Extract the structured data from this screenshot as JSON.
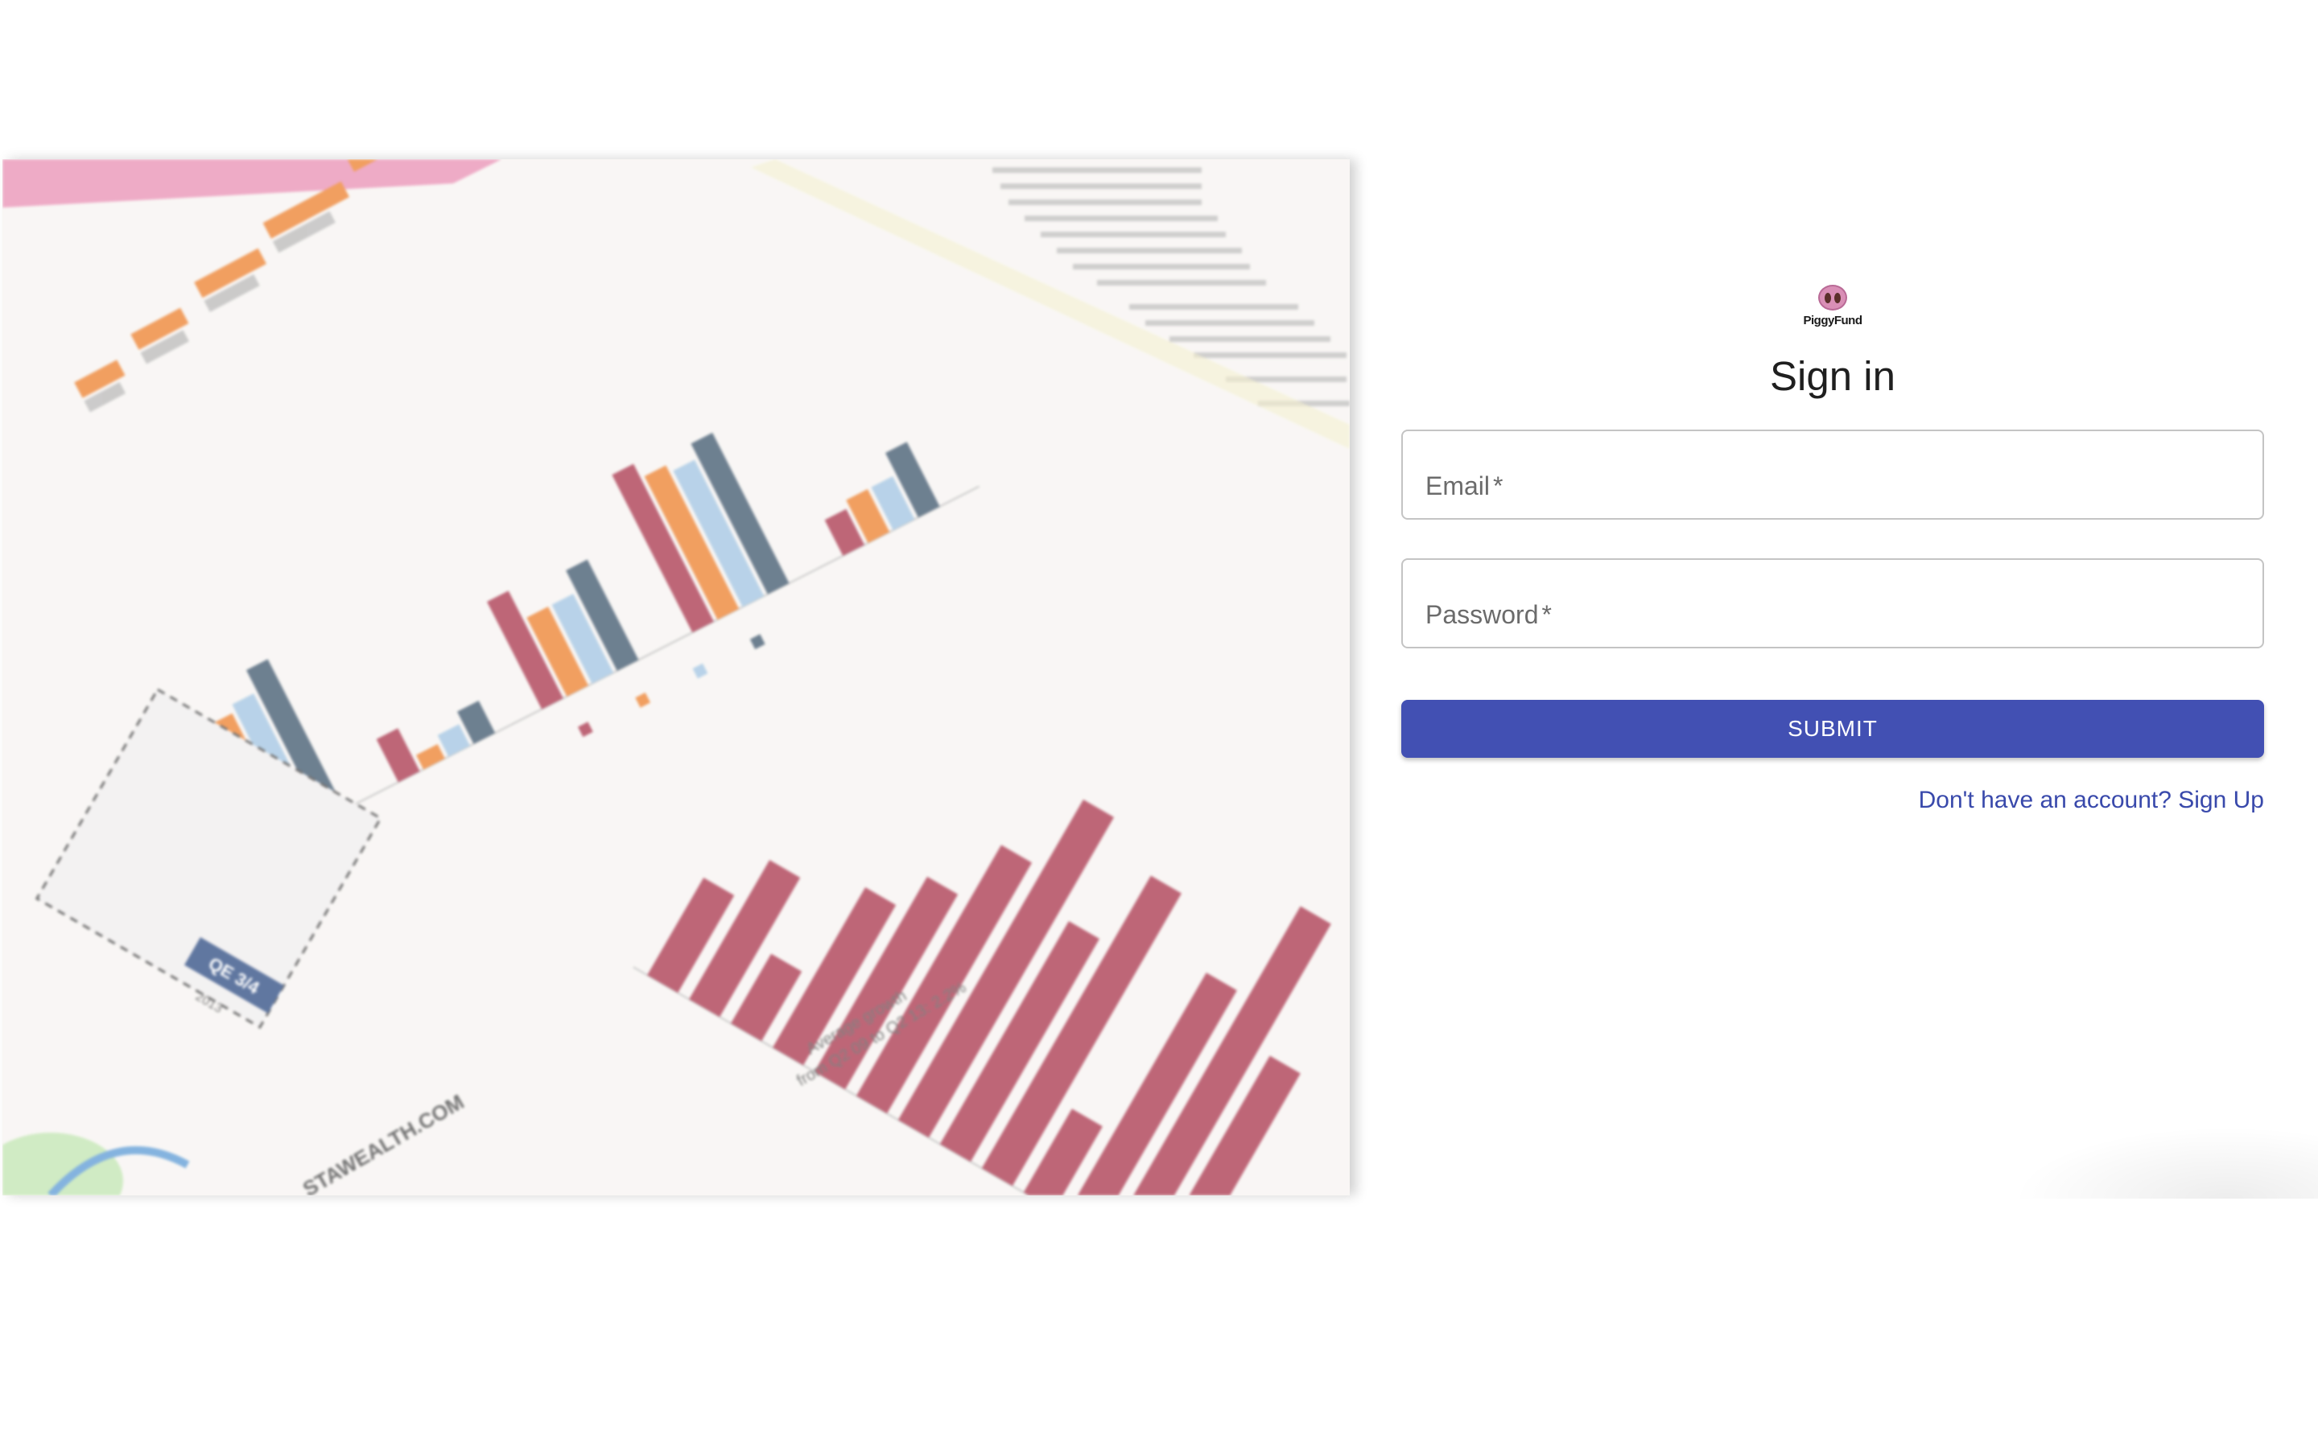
{
  "hero": {
    "image_name": "financial-report-charts-photo",
    "image_text": {
      "report_badge": "QE 3/4",
      "report_year": "2013",
      "report_site": "STAWEALTH.COM",
      "annotation_line_1": "Average growth",
      "annotation_line_2": "from Q2 09 to Q2 13: 2.2%"
    }
  },
  "logo": {
    "icon": "pig-snout-icon",
    "text": "PiggyFund"
  },
  "form": {
    "title": "Sign in",
    "email": {
      "label": "Email",
      "required_mark": "*"
    },
    "password": {
      "label": "Password",
      "required_mark": "*"
    },
    "submit_label": "SUBMIT",
    "signup_link_text": "Don't have an account? Sign Up"
  },
  "colors": {
    "primary": "#4250b3",
    "link": "#3949ab",
    "logo_pink": "#d98fb6",
    "bar_red": "#b0455a",
    "bar_orange": "#ee8a3e",
    "bar_lightblue": "#a9c9e4",
    "bar_slate": "#4e6478"
  }
}
